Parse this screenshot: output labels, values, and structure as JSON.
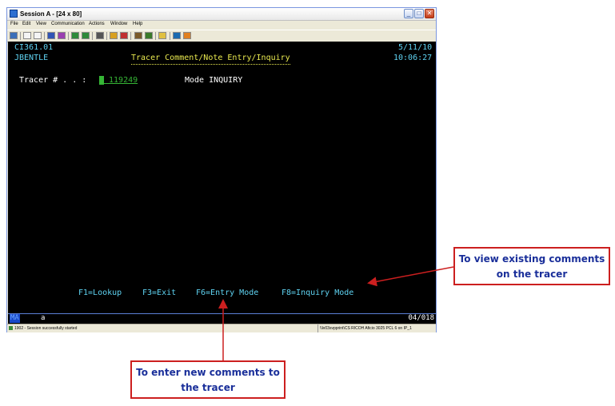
{
  "window": {
    "title": "Session A - [24 x 80]",
    "menu": [
      "File",
      "Edit",
      "View",
      "Communication",
      "Actions",
      "Window",
      "Help"
    ]
  },
  "screen": {
    "program_id": "CI361.01",
    "user": "JBENTLE",
    "title": "Tracer Comment/Note Entry/Inquiry",
    "date": "5/11/10",
    "time": "10:06:27",
    "tracer_label": "Tracer # . . :",
    "tracer_value": " 119249",
    "mode_label": "Mode INQUIRY",
    "function_keys": [
      "F1=Lookup",
      "F3=Exit",
      "F6=Entry Mode",
      "F8=Inquiry Mode"
    ]
  },
  "oia": {
    "indicator": "MA",
    "mode": "a",
    "cursor_position": "04/018"
  },
  "statusbar": {
    "left": "1902 - Session successfully started",
    "right": "\\\\lv03svpprint\\CS RICOH Aficio 3025 PCL 6 on IP_1"
  },
  "callouts": {
    "view_existing": "To view existing comments on the tracer",
    "enter_new": "To enter new comments to the tracer"
  },
  "colors": {
    "terminal_background": "#000000",
    "terminal_green": "#35b535",
    "terminal_cyan": "#5fd3f2",
    "terminal_yellow": "#e9e94f",
    "callout_border": "#cc1f1f",
    "callout_text": "#1a2f9a"
  }
}
